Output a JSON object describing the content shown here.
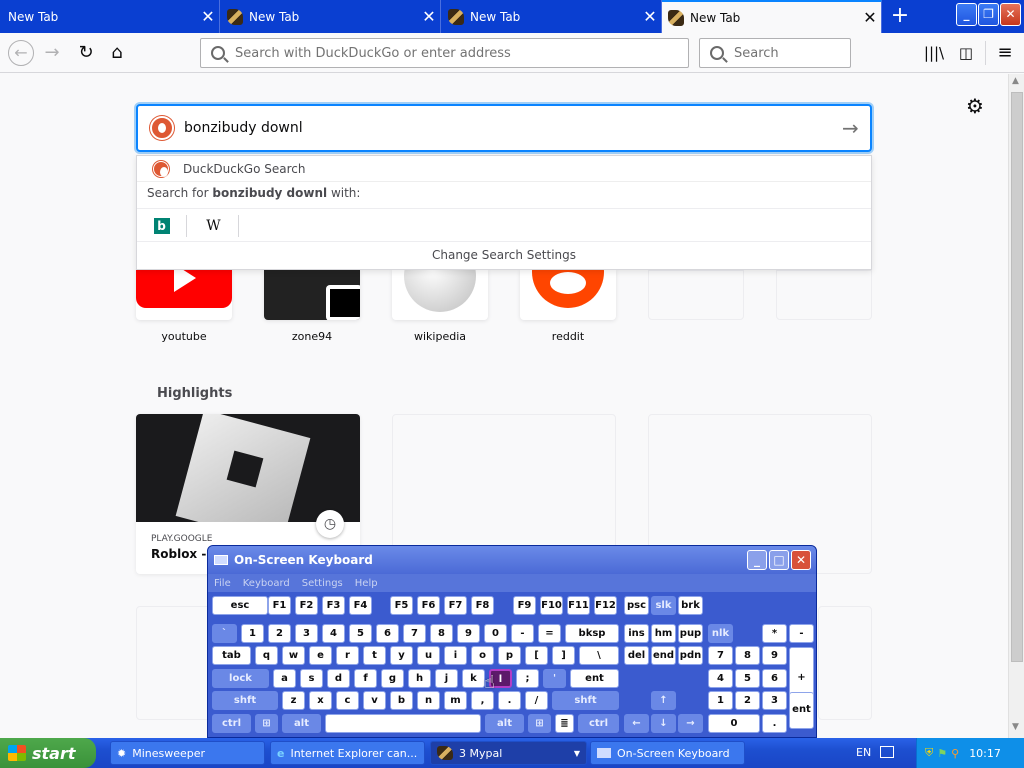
{
  "tabs": [
    {
      "label": "New Tab",
      "active": false
    },
    {
      "label": "New Tab",
      "active": false
    },
    {
      "label": "New Tab",
      "active": false
    },
    {
      "label": "New Tab",
      "active": true
    }
  ],
  "urlbar": {
    "placeholder": "Search with DuckDuckGo or enter address"
  },
  "searchbar": {
    "placeholder": "Search"
  },
  "newtab": {
    "search_value": "bonzibudy downl",
    "suggestion_engine": "DuckDuckGo Search",
    "search_for_prefix": "Search for ",
    "search_for_query": "bonzibudy downl",
    "search_for_suffix": " with:",
    "engines": [
      "bing",
      "W"
    ],
    "change_settings": "Change Search Settings"
  },
  "top_sites": [
    {
      "label": "youtube"
    },
    {
      "label": "zone94"
    },
    {
      "label": "wikipedia"
    },
    {
      "label": "reddit"
    },
    {
      "label": ""
    },
    {
      "label": ""
    }
  ],
  "highlights": {
    "title": "Highlights",
    "cards": [
      {
        "source": "PLAY.GOOGLE",
        "title": "Roblox - A"
      }
    ]
  },
  "osk": {
    "title": "On-Screen Keyboard",
    "menu": [
      "File",
      "Keyboard",
      "Settings",
      "Help"
    ],
    "pressed_key": "h"
  },
  "taskbar": {
    "start": "start",
    "tasks": [
      "Minesweeper",
      "Internet Explorer can...",
      "3 Mypal",
      "On-Screen Keyboard"
    ],
    "lang": "EN",
    "time": "10:17"
  },
  "colors": {
    "tab_bar": "#0a3fd1",
    "accent": "#0a84ff",
    "taskbar": "#1d4fd0"
  }
}
